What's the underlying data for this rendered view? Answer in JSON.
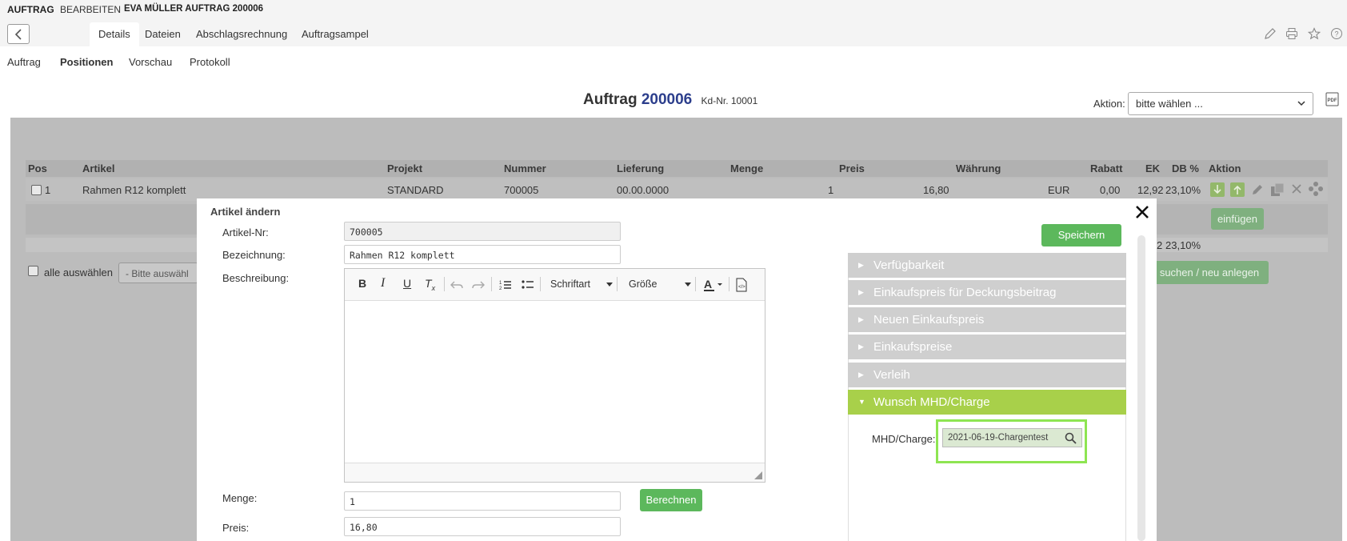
{
  "topbar": {
    "part1": "AUFTRAG",
    "part2": "BEARBEITEN",
    "part3": "EVA MÜLLER AUFTRAG 200006"
  },
  "tabs": [
    "Details",
    "Dateien",
    "Abschlagsrechnung",
    "Auftragsampel"
  ],
  "subnav": [
    "Auftrag",
    "Positionen",
    "Vorschau",
    "Protokoll"
  ],
  "heading": {
    "label": "Auftrag",
    "number": "200006",
    "kd": "Kd-Nr. 10001"
  },
  "aktion": {
    "label": "Aktion:",
    "value": "bitte wählen ..."
  },
  "table": {
    "headers": [
      "Pos",
      "Artikel",
      "Projekt",
      "Nummer",
      "Lieferung",
      "Menge",
      "Preis",
      "Währung",
      "Rabatt",
      "EK",
      "DB %",
      "Aktion"
    ],
    "row": {
      "pos": "1",
      "artikel": "Rahmen R12 komplett",
      "projekt": "STANDARD",
      "nummer": "700005",
      "lieferung": "00.00.0000",
      "menge": "1",
      "preis": "16,80",
      "waehrung": "EUR",
      "rabatt": "0,00",
      "ek": "12,92",
      "db": "23,10%"
    },
    "einfuegen": "einfügen",
    "sum_db": "23,10%",
    "sum_prefix": "2",
    "select_all": "alle auswählen",
    "bulk_select": "- Bitte auswähl",
    "search_new": "suchen / neu anlegen"
  },
  "modal": {
    "title": "Artikel ändern",
    "artikelnr_label": "Artikel-Nr:",
    "artikelnr_value": "700005",
    "bezeichnung_label": "Bezeichnung:",
    "bezeichnung_value": "Rahmen R12 komplett",
    "beschreibung_label": "Beschreibung:",
    "font_select": "Schriftart",
    "size_select": "Größe",
    "menge_label": "Menge:",
    "menge_value": "1",
    "berechnen": "Berechnen",
    "preis_label": "Preis:",
    "preis_value": "16,80",
    "speichern": "Speichern",
    "accordion": [
      "Verfügbarkeit",
      "Einkaufspreis für Deckungsbeitrag",
      "Neuen Einkaufspreis",
      "Einkaufspreise",
      "Verleih",
      "Wunsch MHD/Charge"
    ],
    "mhd_label": "MHD/Charge:",
    "mhd_value": "2021-06-19-Chargentest"
  },
  "colors": {
    "accent_green": "#5cb85c",
    "accordion_open": "#a8d04a",
    "highlight": "#8ee552",
    "heading_number": "#2c3e8c"
  }
}
